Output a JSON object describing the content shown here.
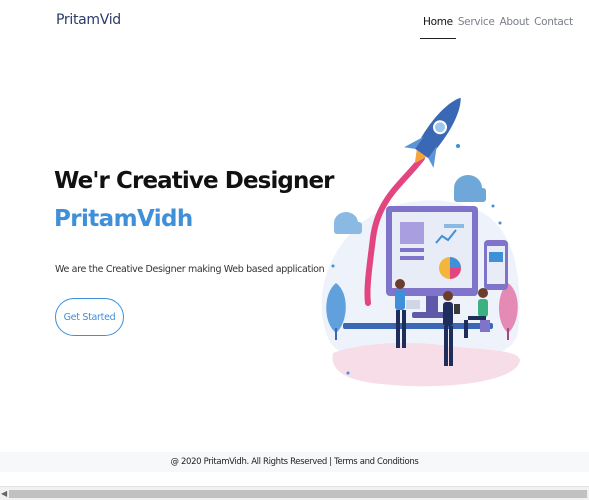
{
  "nav": {
    "brand": "PritamVid",
    "links": [
      "Home",
      "Service",
      "About",
      "Contact"
    ],
    "active": "Home"
  },
  "hero": {
    "title": "We'r Creative Designer",
    "name": "PritamVidh",
    "subtitle": "We are the Creative Designer making Web based application",
    "cta_label": "Get Started"
  },
  "illustration": {
    "icon": "rocket-and-workspace-illustration",
    "accent_color": "#3f8fd9"
  },
  "footer": {
    "text": "@ 2020 PritamVidh. All Rights Reserved | Terms and Conditions"
  },
  "colors": {
    "accent": "#3f8fd9",
    "brand": "#2b3a6b"
  }
}
